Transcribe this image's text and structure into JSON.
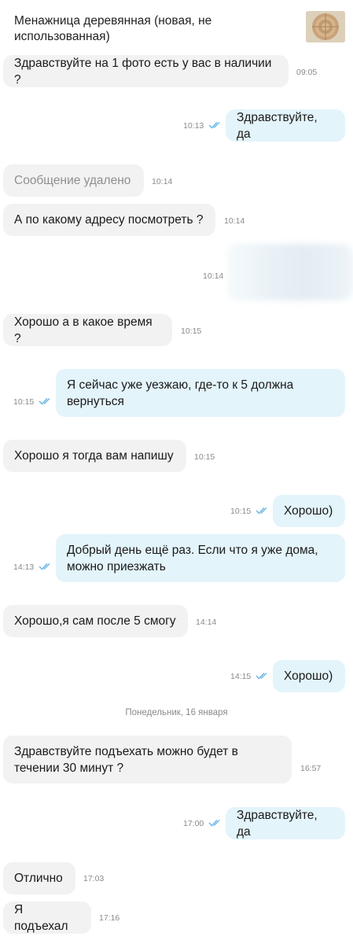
{
  "header": {
    "title": "Менажница деревянная (новая, не использованная)",
    "thumbnail_icon": "wooden-plate-thumbnail-icon"
  },
  "messages": [
    {
      "side": "in",
      "text": "Здравствуйте на 1 фото есть у вас в наличии ?",
      "time": "09:05"
    },
    {
      "side": "out",
      "text": "Здравствуйте, да",
      "time": "10:13",
      "read": true
    },
    {
      "side": "in",
      "text": "Сообщение удалено",
      "time": "10:14",
      "deleted": true
    },
    {
      "side": "in",
      "text": "А по какому адресу посмотреть ?",
      "time": "10:14"
    },
    {
      "side": "out",
      "text": "",
      "time": "10:14",
      "blurred": true
    },
    {
      "side": "in",
      "text": "Хорошо а в какое время ?",
      "time": "10:15"
    },
    {
      "side": "out",
      "text": "Я сейчас уже уезжаю, где-то к 5 должна вернуться",
      "time": "10:15",
      "read": true
    },
    {
      "side": "in",
      "text": "Хорошо я тогда вам напишу",
      "time": "10:15"
    },
    {
      "side": "out",
      "text": "Хорошо)",
      "time": "10:15",
      "read": true
    },
    {
      "side": "out",
      "text": "Добрый день ещё раз. Если что я уже дома, можно приезжать",
      "time": "14:13",
      "read": true
    },
    {
      "side": "in",
      "text": "Хорошо,я сам после 5 смогу",
      "time": "14:14"
    },
    {
      "side": "out",
      "text": "Хорошо)",
      "time": "14:15",
      "read": true
    },
    {
      "side": "in",
      "text": "Здравствуйте подъехать можно будет в течении 30 минут ?",
      "time": "16:57"
    },
    {
      "side": "out",
      "text": "Здравствуйте, да",
      "time": "17:00",
      "read": true
    },
    {
      "side": "in",
      "text": "Отлично",
      "time": "17:03"
    },
    {
      "side": "in",
      "text": "Я подъехал",
      "time": "17:16"
    }
  ],
  "day_separator": "Понедельник, 16 января",
  "colors": {
    "incoming_bubble": "#f2f2f2",
    "outgoing_bubble": "#e3f4fb",
    "read_check": "#6fb8e8",
    "timestamp": "#8a8a8a"
  }
}
